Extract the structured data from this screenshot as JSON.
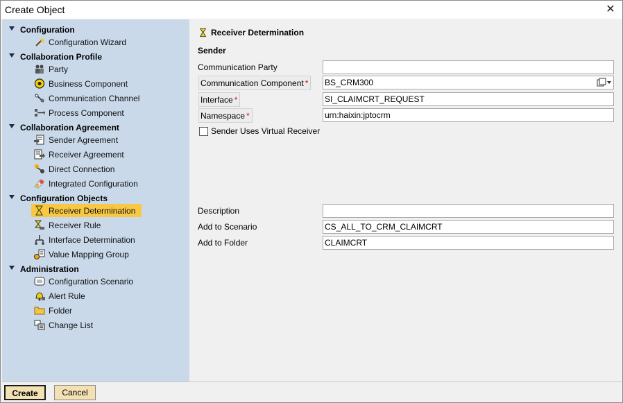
{
  "window": {
    "title": "Create Object",
    "close_label": "✕"
  },
  "sidebar": {
    "sections": [
      {
        "label": "Configuration",
        "items": [
          {
            "label": "Configuration Wizard",
            "icon": "wizard-icon"
          }
        ]
      },
      {
        "label": "Collaboration Profile",
        "items": [
          {
            "label": "Party",
            "icon": "party-icon"
          },
          {
            "label": "Business Component",
            "icon": "business-component-icon"
          },
          {
            "label": "Communication Channel",
            "icon": "communication-channel-icon"
          },
          {
            "label": "Process Component",
            "icon": "process-component-icon"
          }
        ]
      },
      {
        "label": "Collaboration Agreement",
        "items": [
          {
            "label": "Sender Agreement",
            "icon": "sender-agreement-icon"
          },
          {
            "label": "Receiver Agreement",
            "icon": "receiver-agreement-icon"
          },
          {
            "label": "Direct Connection",
            "icon": "direct-connection-icon"
          },
          {
            "label": "Integrated Configuration",
            "icon": "integrated-configuration-icon"
          }
        ]
      },
      {
        "label": "Configuration Objects",
        "items": [
          {
            "label": "Receiver Determination",
            "icon": "receiver-determination-icon",
            "selected": true
          },
          {
            "label": "Receiver Rule",
            "icon": "receiver-rule-icon"
          },
          {
            "label": "Interface Determination",
            "icon": "interface-determination-icon"
          },
          {
            "label": "Value Mapping Group",
            "icon": "value-mapping-icon"
          }
        ]
      },
      {
        "label": "Administration",
        "items": [
          {
            "label": "Configuration Scenario",
            "icon": "configuration-scenario-icon"
          },
          {
            "label": "Alert Rule",
            "icon": "alert-rule-icon"
          },
          {
            "label": "Folder",
            "icon": "folder-icon"
          },
          {
            "label": "Change List",
            "icon": "change-list-icon"
          }
        ]
      }
    ]
  },
  "main": {
    "header": "Receiver Determination",
    "sender_heading": "Sender",
    "fields": {
      "communication_party": {
        "label": "Communication Party",
        "value": ""
      },
      "communication_component": {
        "label": "Communication Component",
        "value": "BS_CRM300"
      },
      "interface": {
        "label": "Interface",
        "value": "SI_CLAIMCRT_REQUEST"
      },
      "namespace": {
        "label": "Namespace",
        "value": "urn:haixin:jptocrm"
      },
      "description": {
        "label": "Description",
        "value": ""
      },
      "add_to_scenario": {
        "label": "Add to Scenario",
        "value": "CS_ALL_TO_CRM_CLAIMCRT"
      },
      "add_to_folder": {
        "label": "Add to Folder",
        "value": "CLAIMCRT"
      }
    },
    "required_marker": "*",
    "virtual_receiver": {
      "label": "Sender Uses Virtual Receiver",
      "checked": false
    }
  },
  "footer": {
    "create_label": "Create",
    "cancel_label": "Cancel"
  },
  "colors": {
    "sidebar_bg": "#c9d9ea",
    "selected_bg": "#f8c844",
    "button_bg": "#f3e1b4",
    "required": "#d01818"
  }
}
